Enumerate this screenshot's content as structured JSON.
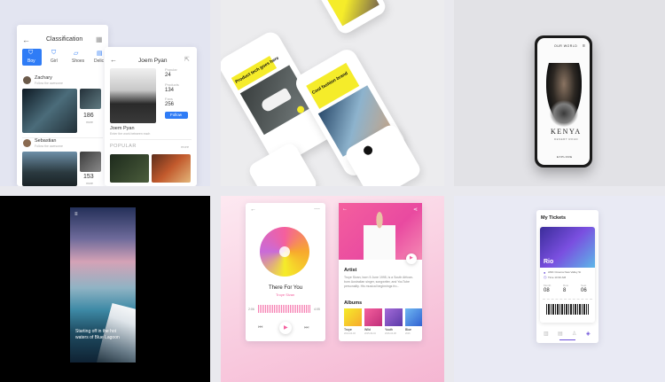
{
  "classification": {
    "title": "Classification",
    "categories": [
      "Boy",
      "Girl",
      "Shoes",
      "Delic"
    ],
    "user1": {
      "name": "Zachary",
      "subtitle": "Follow the awesome",
      "count": "186",
      "count_label": "more"
    },
    "user2": {
      "name": "Sebastian",
      "subtitle": "Follow the awesome",
      "count": "153",
      "count_label": "more"
    }
  },
  "profile": {
    "name": "Joem Pyan",
    "popular_label": "Popular",
    "popular_value": "24",
    "products_label": "Products",
    "products_value": "134",
    "fans_label": "Fans",
    "fans_value": "256",
    "follow_label": "Follow",
    "caption_name": "Joem Pyan",
    "caption_sub": "Enter the work between each",
    "section": "POPULAR",
    "more": "more"
  },
  "ecommerce": {
    "heading_left": "Product tech goes here",
    "heading_right": "Cool fashion brand"
  },
  "kenya": {
    "top_text": "OUR WORLD",
    "title": "KENYA",
    "subtitle": "DESERT ROAD",
    "bottom_text": "EXPLORE"
  },
  "travel": {
    "caption": "Starting off in the hot waters of Blue Lagoon"
  },
  "music": {
    "track_title": "There For You",
    "artist": "Troye Sivan",
    "time_start": "2:06",
    "time_end": "4:05",
    "artist_heading": "Artist",
    "bio": "Troye Sivan, born 5 June 1995, is a South African-born Australian singer, songwriter, and YouTube personality. His musical beginnings fro...",
    "albums_heading": "Albums",
    "albums": [
      {
        "name": "Troye",
        "date": "2014-04-03"
      },
      {
        "name": "Wild",
        "date": "2015-09-04"
      },
      {
        "name": "Youth",
        "date": "2016-04-08"
      },
      {
        "name": "Blue",
        "date": "2016"
      }
    ]
  },
  "tickets": {
    "title": "My Tickets",
    "city": "Rio",
    "venue": "AMC Cinema New Valley St",
    "time": "Time 10:30 AM",
    "label1": "Month",
    "value1": "08",
    "label2": "Row",
    "value2": "8",
    "label3": "Seat",
    "value3": "06"
  },
  "colors": {
    "accent_blue": "#2f7cf6",
    "yellow": "#f5ec2a",
    "pink": "#f45f9e",
    "purple": "#6b4fd8"
  }
}
